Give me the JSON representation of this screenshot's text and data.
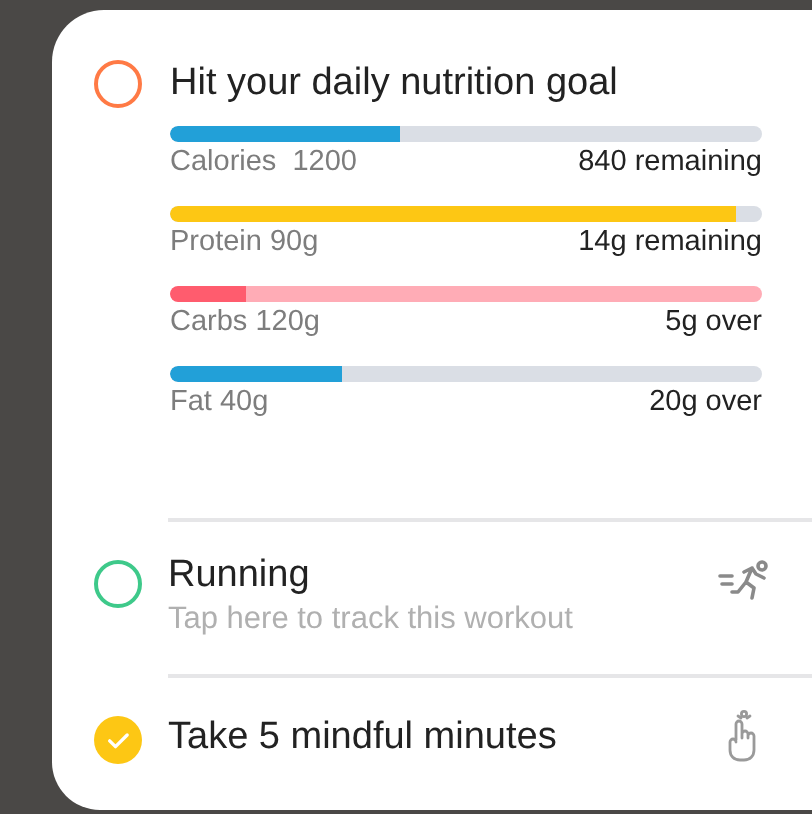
{
  "tasks": [
    {
      "kind": "nutrition",
      "title": "Hit your daily nutrition goal",
      "checked": false,
      "color": "#ff7a45",
      "nutrients": [
        {
          "label": "Calories  1200",
          "status": "840 remaining",
          "level": 0.39,
          "color": "#22a0d8",
          "tinted_track": false
        },
        {
          "label": "Protein 90g",
          "status": "14g remaining",
          "level": 0.955,
          "color": "#fdc714",
          "tinted_track": false
        },
        {
          "label": "Carbs 120g",
          "status": "5g over",
          "level": 0.13,
          "color": "#ff5c6e",
          "tinted_track": true
        },
        {
          "label": "Fat 40g",
          "status": "20g over",
          "level": 0.29,
          "color": "#22a0d8",
          "tinted_track": false
        }
      ]
    },
    {
      "kind": "workout",
      "title": "Running",
      "subtitle": "Tap here to track this workout",
      "checked": false,
      "color": "#3ec98a"
    },
    {
      "kind": "mindful",
      "title": "Take 5 mindful minutes",
      "checked": true,
      "color": "#fdc714"
    }
  ]
}
